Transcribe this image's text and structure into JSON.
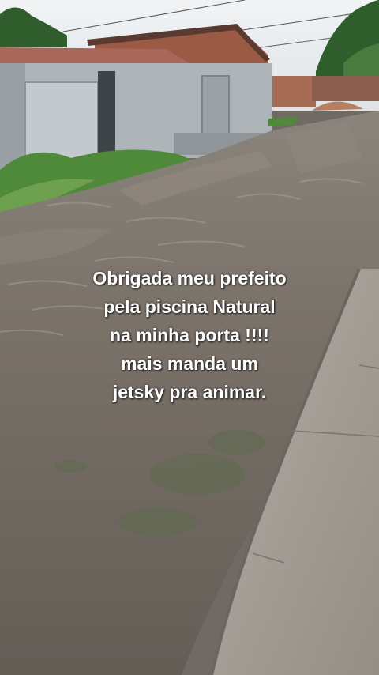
{
  "photo": {
    "subject": "flooded-street",
    "colors": {
      "sky": "#e9ecef",
      "water": "#7c746b",
      "water_dark": "#5a544d",
      "sidewalk": "#a19c93",
      "wall": "#aeb4b8",
      "roof": "#a9675a",
      "brick": "#9a5a44",
      "grass": "#4f8a3a",
      "trees": "#2f5d2c"
    }
  },
  "caption": {
    "lines": [
      "Obrigada meu prefeito",
      "pela piscina Natural",
      "na minha porta !!!!",
      " mais manda um",
      "jetsky pra animar."
    ]
  }
}
